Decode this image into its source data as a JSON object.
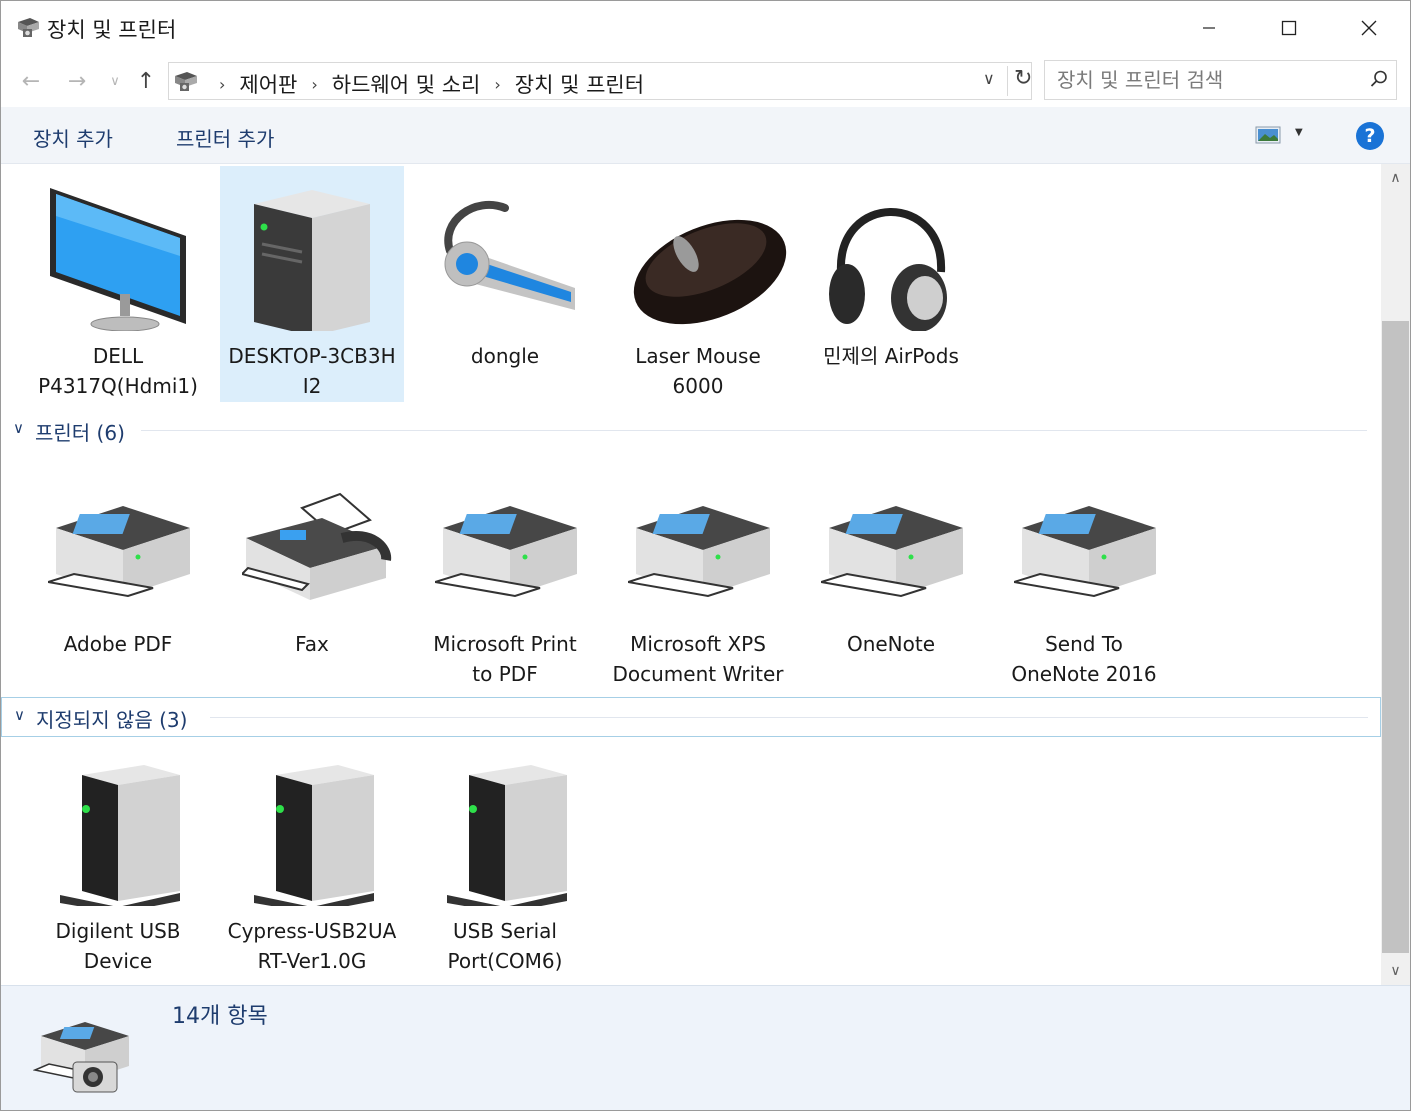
{
  "window": {
    "title": "장치 및 프린터",
    "controls": {
      "minimize": "—",
      "maximize": "☐",
      "close": "✕"
    }
  },
  "address": {
    "breadcrumbs": [
      "제어판",
      "하드웨어 및 소리",
      "장치 및 프린터"
    ],
    "search_placeholder": "장치 및 프린터 검색"
  },
  "commands": {
    "add_device": "장치 추가",
    "add_printer": "프린터 추가",
    "help": "?"
  },
  "groups": {
    "devices": {
      "items": [
        {
          "label": "DELL\nP4317Q(Hdmi1)",
          "icon": "monitor-icon"
        },
        {
          "label": "DESKTOP-3CB3H\nI2",
          "icon": "computer-tower-icon",
          "selected": true
        },
        {
          "label": "dongle",
          "icon": "bluetooth-headset-icon"
        },
        {
          "label": "Laser Mouse\n6000",
          "icon": "mouse-icon"
        },
        {
          "label": "민제의 AirPods",
          "icon": "headphones-icon"
        }
      ]
    },
    "printers": {
      "title": "프린터 (6)",
      "items": [
        {
          "label": "Adobe PDF",
          "icon": "printer-icon"
        },
        {
          "label": "Fax",
          "icon": "fax-icon"
        },
        {
          "label": "Microsoft Print\nto PDF",
          "icon": "printer-icon"
        },
        {
          "label": "Microsoft XPS\nDocument Writer",
          "icon": "printer-icon"
        },
        {
          "label": "OneNote",
          "icon": "printer-icon"
        },
        {
          "label": "Send To\nOneNote 2016",
          "icon": "printer-icon"
        }
      ]
    },
    "unspecified": {
      "title": "지정되지 않음 (3)",
      "items": [
        {
          "label": "Digilent USB\nDevice",
          "icon": "generic-device-icon"
        },
        {
          "label": "Cypress-USB2UA\nRT-Ver1.0G",
          "icon": "generic-device-icon"
        },
        {
          "label": "USB Serial\nPort(COM6)",
          "icon": "generic-device-icon"
        }
      ]
    }
  },
  "status": {
    "count": "14개 항목"
  }
}
